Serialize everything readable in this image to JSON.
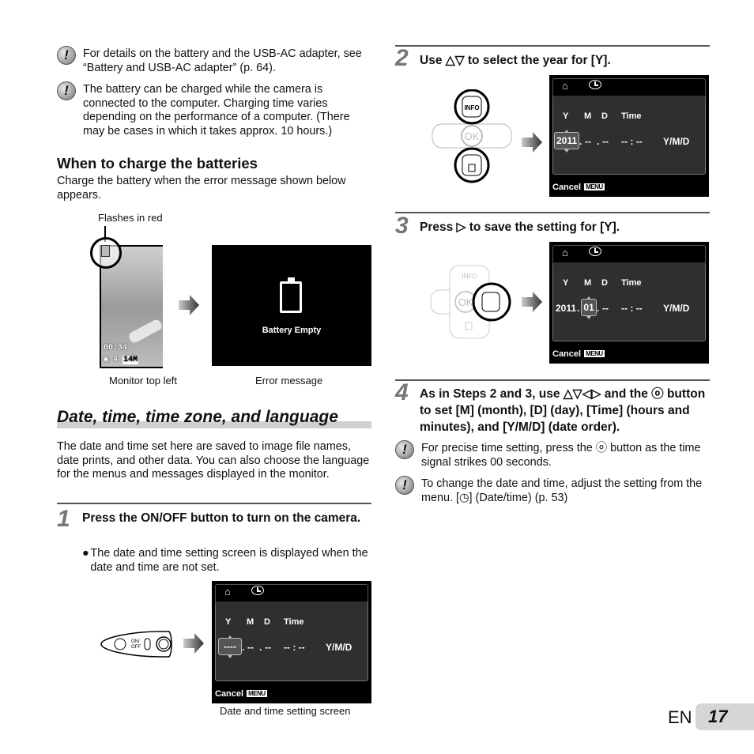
{
  "notes_top": [
    {
      "icon": "caution-icon",
      "text": "For details on the battery and the USB-AC adapter, see “Battery and USB-AC adapter” (p. 64)."
    },
    {
      "icon": "caution-icon",
      "text": "The battery can be charged while the camera is connected to the computer. Charging time varies depending on the performance of a computer. (There may be cases in which it takes approx. 10 hours.)"
    }
  ],
  "charge_section": {
    "heading": "When to charge the batteries",
    "body": "Charge the battery when the error message shown below appears.",
    "callout": "Flashes in red",
    "monitor_readout": {
      "time": "00:34",
      "shots": "4",
      "size": "14M"
    },
    "error_message": "Battery Empty",
    "caption_left": "Monitor top left",
    "caption_right": "Error message"
  },
  "date_section": {
    "title": "Date, time, time zone, and language",
    "body": "The date and time set here are saved to image file names, date prints, and other data. You can also choose the language for the menus and messages displayed in the monitor."
  },
  "steps": [
    {
      "num": "1",
      "text": "Press the ON/OFF button to turn on the camera.",
      "bullet": "The date and time setting screen is displayed when the date and time are not set.",
      "button_label": "ON/OFF",
      "caption": "Date and time setting screen"
    },
    {
      "num": "2",
      "text": "Use △▽ to select the year for [Y].",
      "button_labels": [
        "INFO",
        "OK"
      ]
    },
    {
      "num": "3",
      "text": "Press ▷ to save the setting for [Y].",
      "button_labels": [
        "INFO",
        "OK"
      ]
    },
    {
      "num": "4",
      "text": "As in Steps 2 and 3, use △▽◁▷ and the ⓞ button to set [M] (month), [D] (day), [Time] (hours and minutes), and [Y/M/D] (date order)."
    }
  ],
  "lcd_screens": [
    {
      "headers": {
        "y": "Y",
        "m": "M",
        "d": "D",
        "time": "Time"
      },
      "year": "----",
      "month": "--",
      "day": "--",
      "time": "-- : --",
      "order": "Y/M/D",
      "cancel": "Cancel",
      "menu": "MENU",
      "selected": "year"
    },
    {
      "headers": {
        "y": "Y",
        "m": "M",
        "d": "D",
        "time": "Time"
      },
      "year": "2011",
      "month": "--",
      "day": "--",
      "time": "-- : --",
      "order": "Y/M/D",
      "cancel": "Cancel",
      "menu": "MENU",
      "selected": "year"
    },
    {
      "headers": {
        "y": "Y",
        "m": "M",
        "d": "D",
        "time": "Time"
      },
      "year": "2011",
      "month": "01",
      "day": "--",
      "time": "-- : --",
      "order": "Y/M/D",
      "cancel": "Cancel",
      "menu": "MENU",
      "selected": "month"
    }
  ],
  "notes_bottom": [
    {
      "icon": "caution-icon",
      "text": "For precise time setting, press the ⓞ button as the time signal strikes 00 seconds."
    },
    {
      "icon": "caution-icon",
      "text": "To change the date and time, adjust the setting from the menu. [◷] (Date/time) (p. 53)"
    }
  ],
  "footer": {
    "lang": "EN",
    "page": "17"
  }
}
